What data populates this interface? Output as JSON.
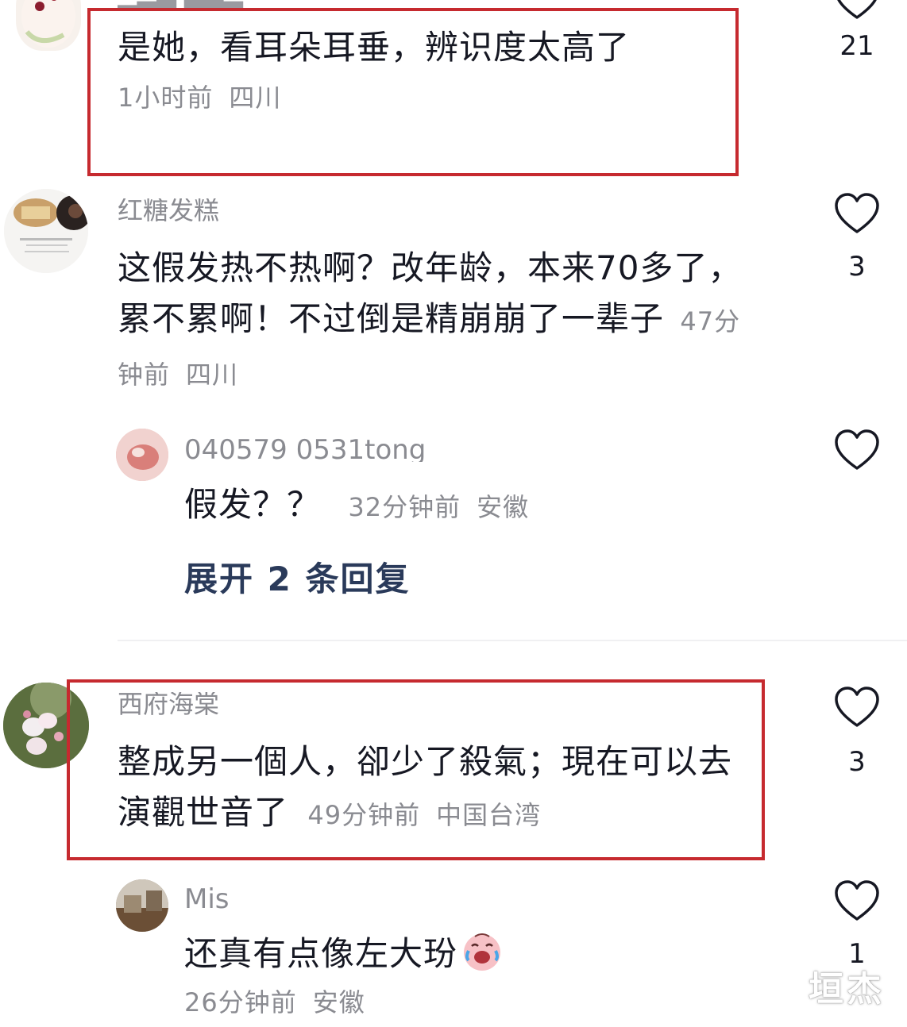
{
  "comments": [
    {
      "text": "是她，看耳朵耳垂，辨识度太高了",
      "time": "1小时前",
      "location": "四川",
      "likes": "21"
    },
    {
      "name": "红糖发糕",
      "text": "这假发热不热啊？改年龄，本来70多了，累不累啊！不过倒是精崩崩了一辈子",
      "time": "47分钟前",
      "location": "四川",
      "likes": "3",
      "reply": {
        "name": "040579 0531tong",
        "text": "假发？？",
        "time": "32分钟前",
        "location": "安徽"
      },
      "expand_label": "展开 2 条回复"
    },
    {
      "name": "西府海棠",
      "text": "整成另一個人，卻少了殺氣；現在可以去演觀世音了",
      "time": "49分钟前",
      "location": "中国台湾",
      "likes": "3",
      "reply": {
        "name": "Mis",
        "text": "还真有点像左大玢",
        "emoji": "crying-laughing-face",
        "time": "26分钟前",
        "location": "安徽",
        "likes": "1"
      }
    }
  ],
  "watermark": "垣杰",
  "colors": {
    "highlight_box": "#c62a2f",
    "text": "#161823",
    "meta": "#8a8b91",
    "expand": "#2a3a5a"
  }
}
